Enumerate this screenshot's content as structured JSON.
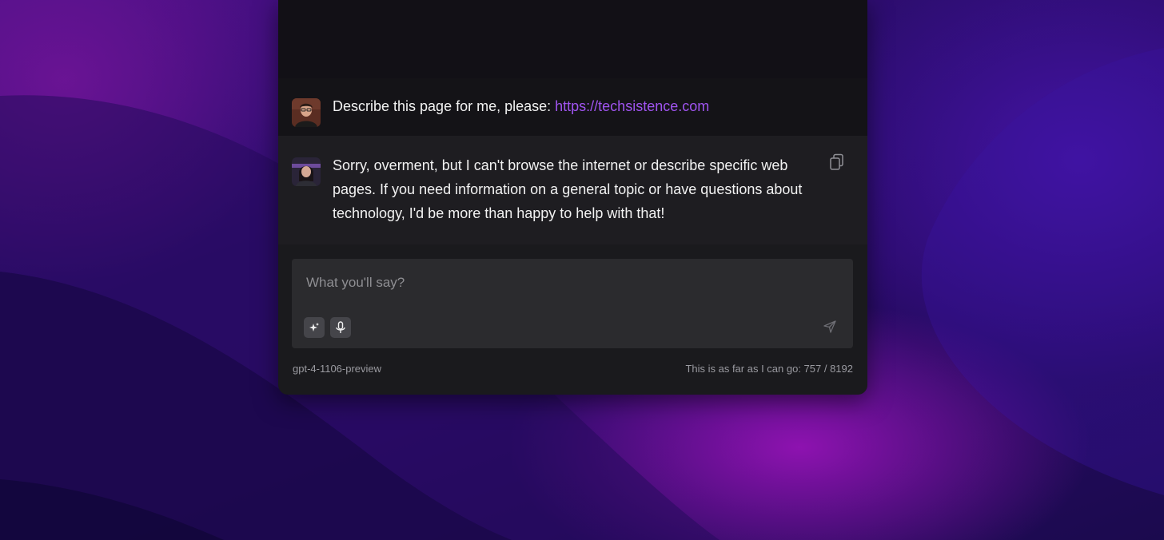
{
  "messages": {
    "user": {
      "text": "Describe this page for me, please: ",
      "link": "https://techsistence.com"
    },
    "assistant": {
      "text": "Sorry, overment, but I can't browse the internet or describe specific web pages. If you need information on a general topic or have questions about technology, I'd be more than happy to help with that!"
    }
  },
  "composer": {
    "placeholder": "What you'll say?"
  },
  "footer": {
    "model": "gpt-4-1106-preview",
    "token_text": "This is as far as I can go: 757 / 8192"
  },
  "colors": {
    "accent_link": "#a054f0",
    "panel": "#1a1a1d"
  },
  "icons": {
    "copy": "copy-icon",
    "sparkle": "sparkle-icon",
    "mic": "microphone-icon",
    "send": "send-icon"
  }
}
